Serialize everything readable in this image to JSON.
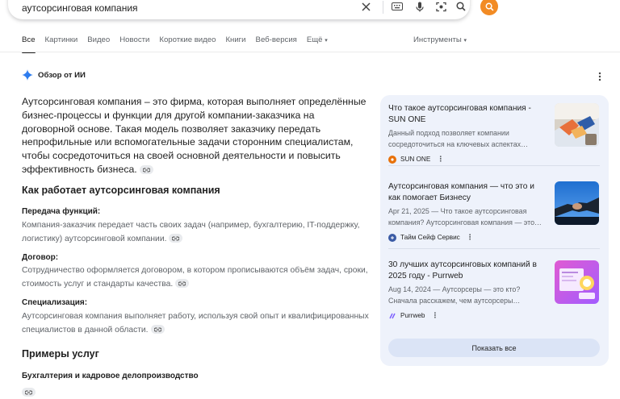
{
  "search": {
    "query": "аутсорсинговая компания"
  },
  "tabs": [
    {
      "label": "Все",
      "active": true
    },
    {
      "label": "Картинки"
    },
    {
      "label": "Видео"
    },
    {
      "label": "Новости"
    },
    {
      "label": "Короткие видео"
    },
    {
      "label": "Книги"
    },
    {
      "label": "Веб-версия"
    },
    {
      "label": "Ещё"
    }
  ],
  "tools_label": "Инструменты",
  "ai": {
    "title": "Обзор от ИИ",
    "intro": "Аутсорсинговая компания – это фирма, которая выполняет определённые бизнес-процессы и функции для другой компании-заказчика на договорной основе. Такая модель позволяет заказчику передать непрофильные или вспомогательные задачи сторонним специалистам, чтобы сосредоточиться на своей основной деятельности и повысить эффективность бизнеса.",
    "section1_title": "Как работает аутсорсинговая компания",
    "items": [
      {
        "title": "Передача функций:",
        "text": "Компания-заказчик передает часть своих задач (например, бухгалтерию, IT-поддержку, логистику) аутсорсинговой компании."
      },
      {
        "title": "Договор:",
        "text": "Сотрудничество оформляется договором, в котором прописываются объём задач, сроки, стоимость услуг и стандарты качества."
      },
      {
        "title": "Специализация:",
        "text": "Аутсорсинговая компания выполняет работу, используя свой опыт и квалифицированных специалистов в данной области."
      }
    ],
    "section2_title": "Примеры услуг",
    "service1": "Бухгалтерия и кадровое делопроизводство"
  },
  "sources": [
    {
      "title": "Что такое аутсорсинговая компания - SUN ONE",
      "snippet": "Данный подход позволяет компании сосредоточиться на ключевых аспектах…",
      "site": "SUN ONE",
      "logo_color": "#e8710a"
    },
    {
      "title": "Аутсорсинговая компания — что это и как помогает Бизнесу",
      "snippet": "Apr 21, 2025 — Что такое аутсорсинговая компания? Аутсорсинговая компания — это…",
      "site": "Тайм Сейф Сервис",
      "logo_color": "#3b5ba5"
    },
    {
      "title": "30 лучших аутсорсинговых компаний в 2025 году - Purrweb",
      "snippet": "Aug 14, 2024 — Аутсорсеры — это кто? Сначала расскажем, чем аутсорсеры…",
      "site": "Purrweb",
      "logo_color": "#7b5cff"
    }
  ],
  "show_all_label": "Показать все"
}
